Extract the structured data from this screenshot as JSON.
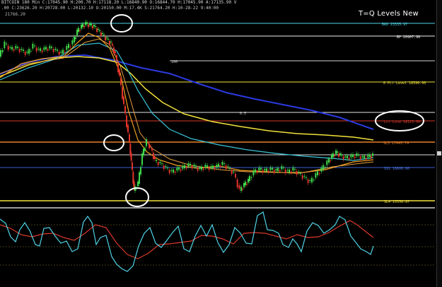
{
  "header": {
    "line1": "BITCOIN 180 Min  C:17045.90  H:200.70  H:17118.20  L:16840.90  O:16844.70  H:17045.90  A:17135.90  V",
    "line2": ".00  C:23626.20  H:20728.00  L:20132.10  O:20150.00  M:17.4K  S:21764.20  H:10-28-22  9:40:00",
    "price_top": "21766.20"
  },
  "title": "T=Q Levels New",
  "levels": [
    {
      "label": "BKD 23335.97",
      "color": "#4fd3e6"
    },
    {
      "label": "BP 20907.90",
      "color": "#f0f0f0"
    },
    {
      "label": "0 Pct Level 18390.90",
      "color": "#f2e23a"
    },
    {
      "label": "Lst Line 18123.00",
      "color": "#d83a2a"
    },
    {
      "label": "SL3 17445.74",
      "color": "#e9802a"
    },
    {
      "label": "SS1 16800.00",
      "color": "#3a5fd0"
    },
    {
      "label": "SL4 15550.87",
      "color": "#f2e23a"
    }
  ],
  "fib_labels": [
    "100",
    "0.5"
  ],
  "colors": {
    "background": "#000000",
    "candle_up": "#3fd84a",
    "candle_down": "#e0342a",
    "ema_fast": "#f2a020",
    "ema_mid": "#f2e23a",
    "ema_cyan": "#38c4d8",
    "ma_blue": "#2a3ae0",
    "osc_line": "#4fd3e6",
    "osc_signal": "#d83a2a",
    "annotation": "#ffffff"
  },
  "annotations": [
    "circle-annotation",
    "circle-annotation",
    "circle-annotation",
    "ellipse-annotation"
  ]
}
